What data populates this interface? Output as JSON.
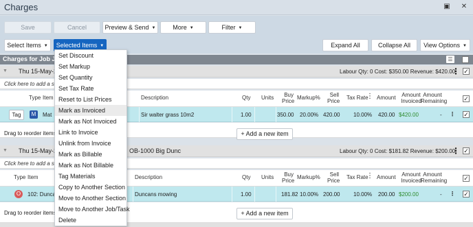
{
  "window": {
    "title": "Charges"
  },
  "toolbar": {
    "save": "Save",
    "cancel": "Cancel",
    "preview_send": "Preview & Send",
    "more": "More",
    "filter": "Filter",
    "select_items": "Select Items",
    "selected_items": "Selected Items",
    "expand_all": "Expand All",
    "collapse_all": "Collapse All",
    "view_options": "View Options"
  },
  "grid": {
    "header": "Charges for Job JOB"
  },
  "menu": {
    "items": [
      "Set Discount",
      "Set Markup",
      "Set Quantity",
      "Set Tax Rate",
      "Reset to List Prices",
      "Mark as Invoiced",
      "Mark as Not Invoiced",
      "Link to Invoice",
      "Unlink from Invoice",
      "Mark as Billable",
      "Mark as Not Billable",
      "Tag Materials",
      "Copy to Another Section",
      "Move to Another Section",
      "Move to Another Job/Task",
      "Delete"
    ],
    "highlighted_index": 5
  },
  "columns": {
    "type": "Type",
    "item": "Item",
    "description": "Description",
    "qty": "Qty",
    "units": "Units",
    "buy_price": "Buy Price",
    "markup": "Markup%",
    "sell_price": "Sell Price",
    "tax_rate": "Tax Rate",
    "amount": "Amount",
    "amount_invoiced": "Amount Invoiced",
    "amount_remaining": "Amount Remaining"
  },
  "sections": [
    {
      "title_left": "Thu 15-May-2",
      "summary": "Labour Qty: 0  Cost: $350.00  Revenue: $420.00",
      "click_add": "Click here to add a sect",
      "row": {
        "tag": "Tag",
        "type_badge": "M",
        "item": "Mat",
        "description": "Sir walter grass 10m2",
        "qty": "1.00",
        "buy_price": "350.00",
        "markup": "20.00%",
        "sell_price": "420.00",
        "tax_rate": "10.00%",
        "amount": "420.00",
        "amount_invoiced": "$420.00",
        "amount_remaining": "-"
      },
      "reorder": "Drag to reorder items",
      "add_new": "+ Add a new item"
    },
    {
      "title_left": "Thu 15-May-2",
      "title_right": "OB-1000 Big Dunc",
      "summary": "Labour Qty: 0  Cost: $181.82  Revenue: $200.00",
      "click_add": "Click here to add a sect",
      "row": {
        "type_badge": "O",
        "item": "102: Duncan",
        "description": "Duncans mowing",
        "qty": "1.00",
        "buy_price": "181.82",
        "markup": "10.00%",
        "sell_price": "200.00",
        "tax_rate": "10.00%",
        "amount": "200.00",
        "amount_invoiced": "$200.00",
        "amount_remaining": "-"
      },
      "reorder": "Drag to reorder items",
      "add_new": "+ Add a new item"
    }
  ],
  "colors": {
    "accent": "#1565c0",
    "row_bg": "#bfe8ee",
    "invoiced_green": "#2e8b2e"
  }
}
